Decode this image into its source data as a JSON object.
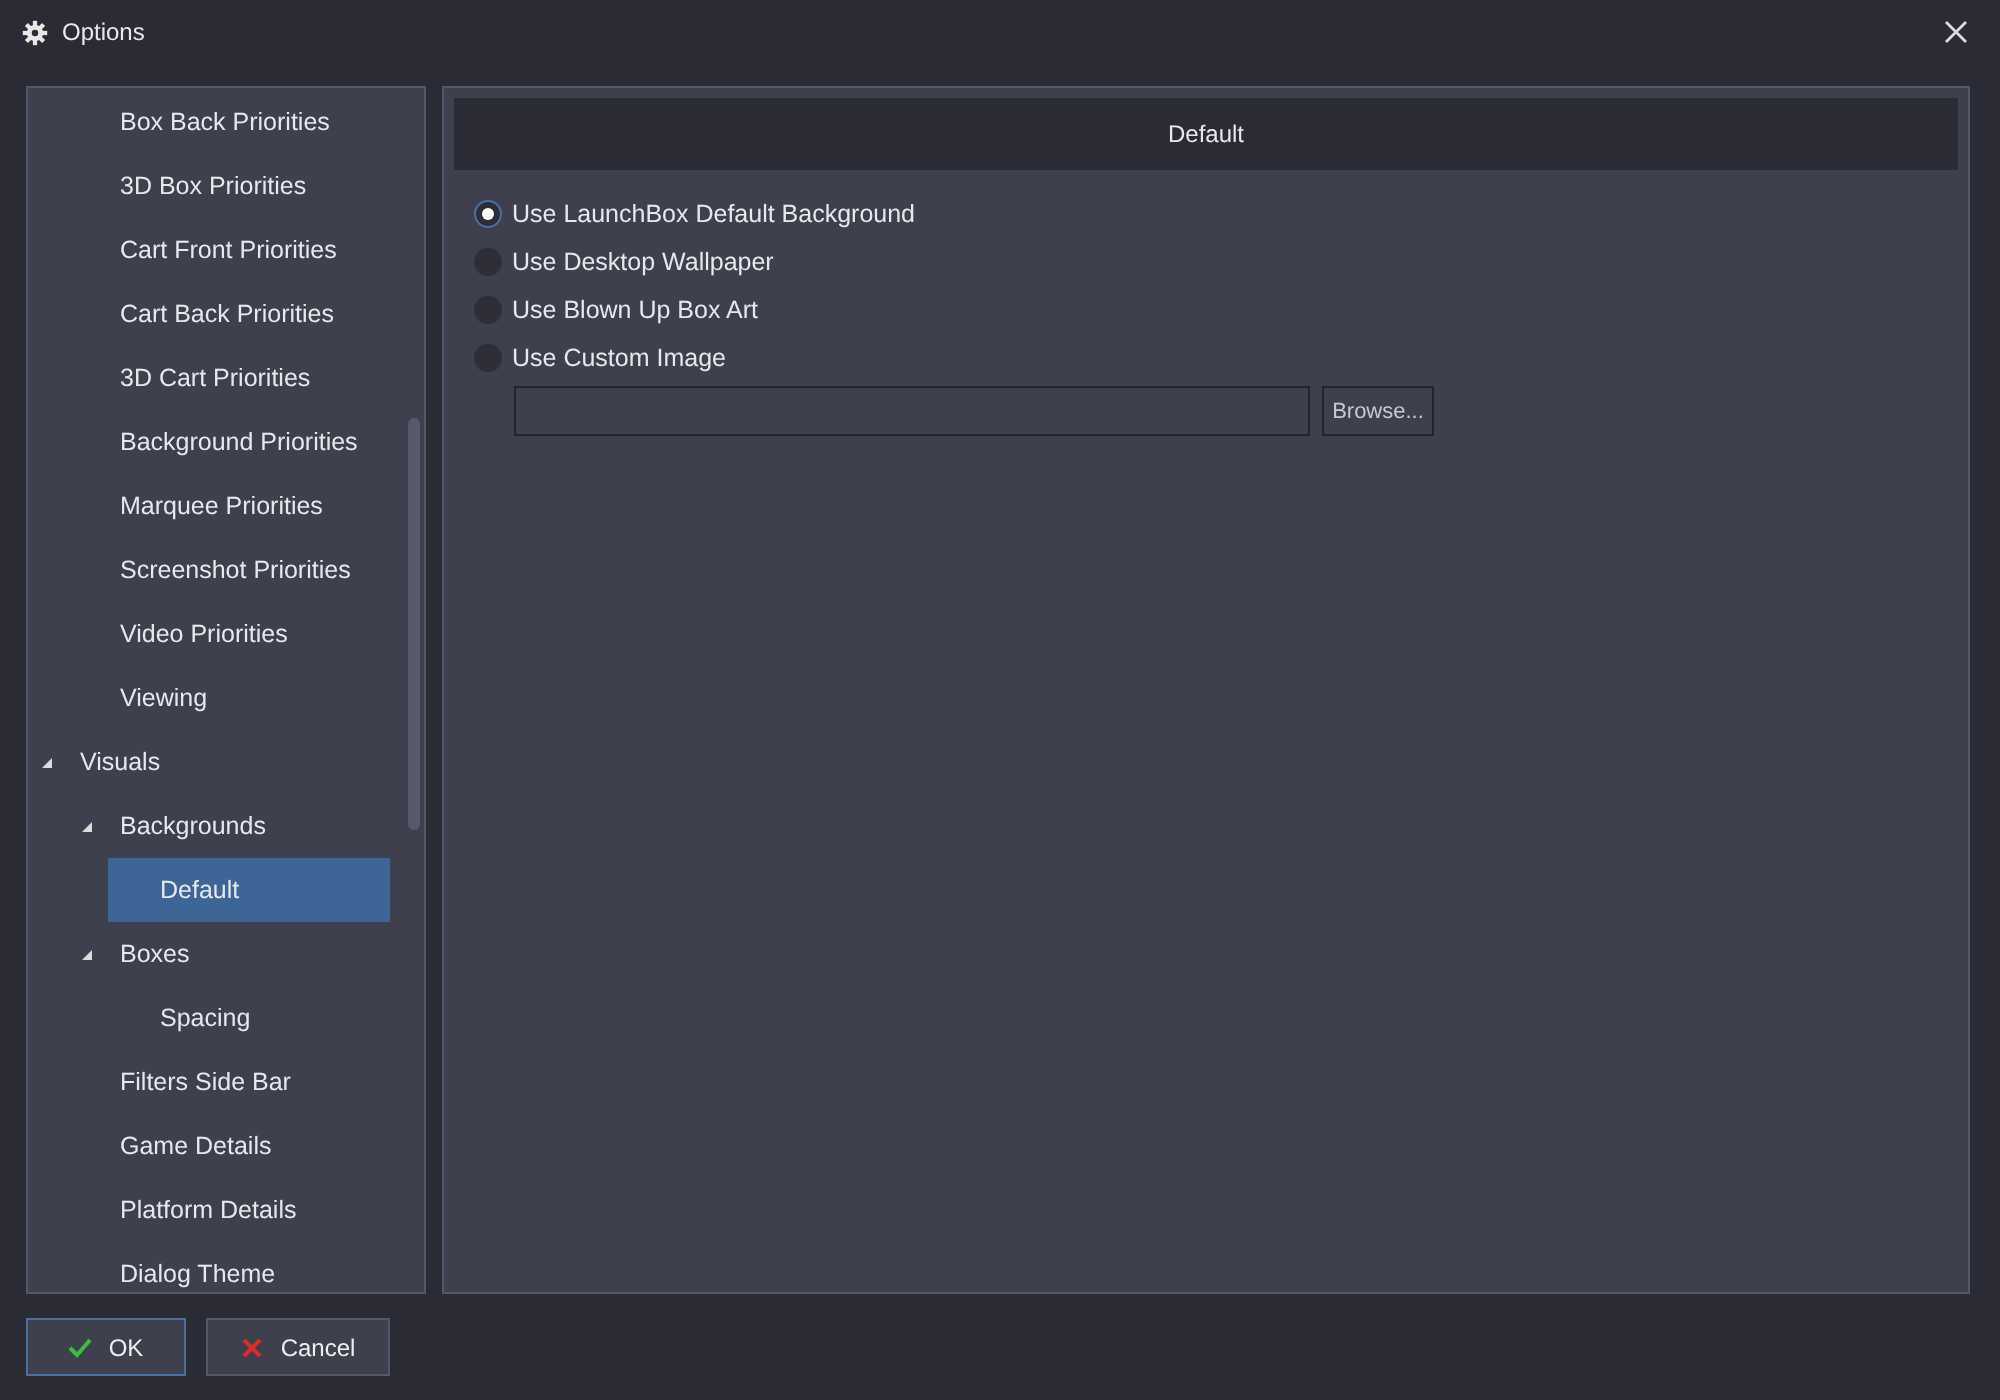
{
  "window": {
    "title": "Options"
  },
  "tree": {
    "items": [
      {
        "children": [
          {
            "label": "Box Back Priorities",
            "selected": false
          },
          {
            "label": "3D Box Priorities",
            "selected": false
          },
          {
            "label": "Cart Front Priorities",
            "selected": false
          },
          {
            "label": "Cart Back Priorities",
            "selected": false
          },
          {
            "label": "3D Cart Priorities",
            "selected": false
          },
          {
            "label": "Background Priorities",
            "selected": false
          },
          {
            "label": "Marquee Priorities",
            "selected": false
          },
          {
            "label": "Screenshot Priorities",
            "selected": false
          },
          {
            "label": "Video Priorities",
            "selected": false
          },
          {
            "label": "Viewing",
            "selected": false
          }
        ]
      },
      {
        "label": "Visuals",
        "selected": false,
        "expanded": true,
        "children": [
          {
            "label": "Backgrounds",
            "selected": false,
            "expanded": true,
            "children": [
              {
                "label": "Default",
                "selected": true
              }
            ]
          },
          {
            "label": "Boxes",
            "selected": false,
            "expanded": true,
            "children": [
              {
                "label": "Spacing",
                "selected": false
              }
            ]
          },
          {
            "label": "Filters Side Bar",
            "selected": false
          },
          {
            "label": "Game Details",
            "selected": false
          },
          {
            "label": "Platform Details",
            "selected": false
          },
          {
            "label": "Dialog Theme",
            "selected": false
          }
        ]
      }
    ]
  },
  "panel": {
    "header": "Default",
    "options": [
      {
        "label": "Use LaunchBox Default Background",
        "selected": true
      },
      {
        "label": "Use Desktop Wallpaper",
        "selected": false
      },
      {
        "label": "Use Blown Up Box Art",
        "selected": false
      },
      {
        "label": "Use Custom Image",
        "selected": false
      }
    ],
    "browse_button": "Browse..."
  },
  "buttons": [
    {
      "label": "OK",
      "kind": "ok"
    },
    {
      "label": "Cancel",
      "kind": "cancel"
    }
  ]
}
